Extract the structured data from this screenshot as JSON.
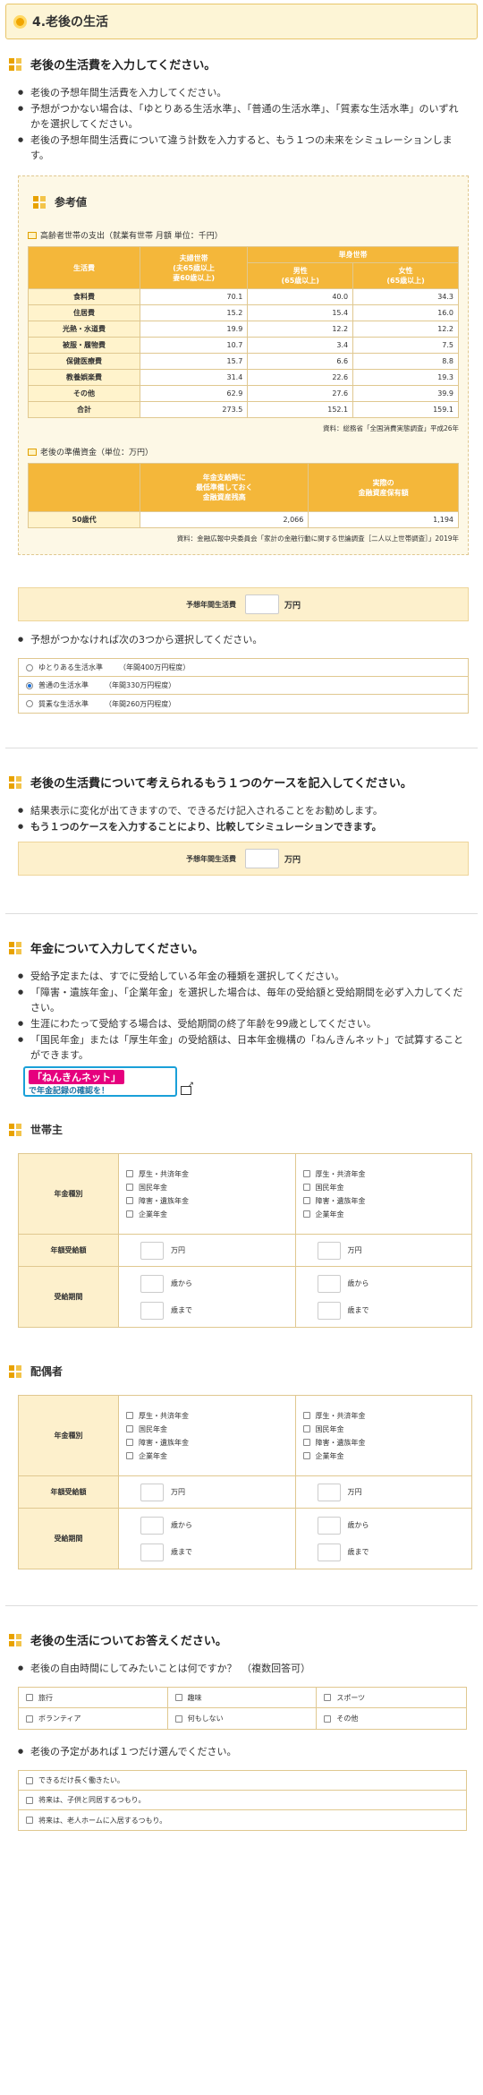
{
  "section": {
    "title": "4.老後の生活"
  },
  "expense": {
    "heading": "老後の生活費を入力してください。",
    "bullets": [
      "老後の予想年間生活費を入力してください。",
      "予想がつかない場合は、「ゆとりある生活水準」、「普通の生活水準」、「質素な生活水準」のいずれかを選択してください。",
      "老後の予想年間生活費について違う計数を入力すると、もう１つの未来をシミュレーションします。"
    ]
  },
  "reference": {
    "title": "参考値",
    "table1_caption": "高齢者世帯の支出（就業有世帯 月額 単位：千円）",
    "table1_headers": {
      "col0": "生活費",
      "col1": "夫婦世帯\n(夫65歳以上\n妻60歳以上)",
      "single": "単身世帯",
      "male": "男性\n(65歳以上)",
      "female": "女性\n(65歳以上)"
    },
    "table1_rows": [
      {
        "label": "食料費",
        "v1": "70.1",
        "v2": "40.0",
        "v3": "34.3"
      },
      {
        "label": "住居費",
        "v1": "15.2",
        "v2": "15.4",
        "v3": "16.0"
      },
      {
        "label": "光熱・水道費",
        "v1": "19.9",
        "v2": "12.2",
        "v3": "12.2"
      },
      {
        "label": "被服・履物費",
        "v1": "10.7",
        "v2": "3.4",
        "v3": "7.5"
      },
      {
        "label": "保健医療費",
        "v1": "15.7",
        "v2": "6.6",
        "v3": "8.8"
      },
      {
        "label": "教養娯楽費",
        "v1": "31.4",
        "v2": "22.6",
        "v3": "19.3"
      },
      {
        "label": "その他",
        "v1": "62.9",
        "v2": "27.6",
        "v3": "39.9"
      },
      {
        "label": "合計",
        "v1": "273.5",
        "v2": "152.1",
        "v3": "159.1"
      }
    ],
    "table1_source": "資料：総務省「全国消費実態調査」平成26年",
    "table2_caption": "老後の準備資金（単位：万円）",
    "table2_headers": {
      "col1": "年金支給時に\n最低準備しておく\n金融資産残高",
      "col2": "実際の\n金融資産保有額"
    },
    "table2_row": {
      "label": "50歳代",
      "v1": "2,066",
      "v2": "1,194"
    },
    "table2_source": "資料：金融広報中央委員会「家計の金融行動に関する世論調査［二人以上世帯調査］」2019年"
  },
  "prediction": {
    "label": "予想年間生活費",
    "unit": "万円"
  },
  "choose_bullet": "予想がつかなければ次の3つから選択してください。",
  "options": [
    {
      "name": "ゆとりある生活水準",
      "desc": "（年間400万円程度）",
      "selected": false
    },
    {
      "name": "普通の生活水準",
      "desc": "（年間330万円程度）",
      "selected": true
    },
    {
      "name": "質素な生活水準",
      "desc": "（年間260万円程度）",
      "selected": false
    }
  ],
  "another_case": {
    "heading": "老後の生活費について考えられるもう１つのケースを記入してください。",
    "bullets": [
      "結果表示に変化が出てきますので、できるだけ記入されることをお勧めします。",
      "もう１つのケースを入力することにより、比較してシミュレーションできます。"
    ],
    "label": "予想年間生活費",
    "unit": "万円"
  },
  "pension": {
    "heading": "年金について入力してください。",
    "bullets": [
      "受給予定または、すでに受給している年金の種類を選択してください。",
      "「障害・遺族年金」、「企業年金」を選択した場合は、毎年の受給額と受給期間を必ず入力してください。",
      "生涯にわたって受給する場合は、受給期間の終了年齢を99歳としてください。",
      "「国民年金」または「厚生年金」の受給額は、日本年金機構の「ねんきんネット」で試算することができます。"
    ],
    "banner_line1": "「ねんきんネット」",
    "banner_line2": "で年金記録の確認を！"
  },
  "householder": {
    "title": "世帯主"
  },
  "spouse": {
    "title": "配偶者"
  },
  "pension_form": {
    "type_label": "年金種別",
    "amount_label": "年額受給額",
    "period_label": "受給期間",
    "types": [
      "厚生・共済年金",
      "国民年金",
      "障害・遺族年金",
      "企業年金"
    ],
    "unit": "万円",
    "from": "歳から",
    "to": "歳まで"
  },
  "life": {
    "heading": "老後の生活についてお答えください。",
    "q1": "老後の自由時間にしてみたいことは何ですか？　（複数回答可）",
    "q1_options": [
      "旅行",
      "趣味",
      "スポーツ",
      "ボランティア",
      "何もしない",
      "その他"
    ],
    "q2": "老後の予定があれば１つだけ選んでください。",
    "q2_options": [
      "できるだけ長く働きたい。",
      "将来は、子供と同居するつもり。",
      "将来は、老人ホームに入居するつもり。"
    ]
  }
}
